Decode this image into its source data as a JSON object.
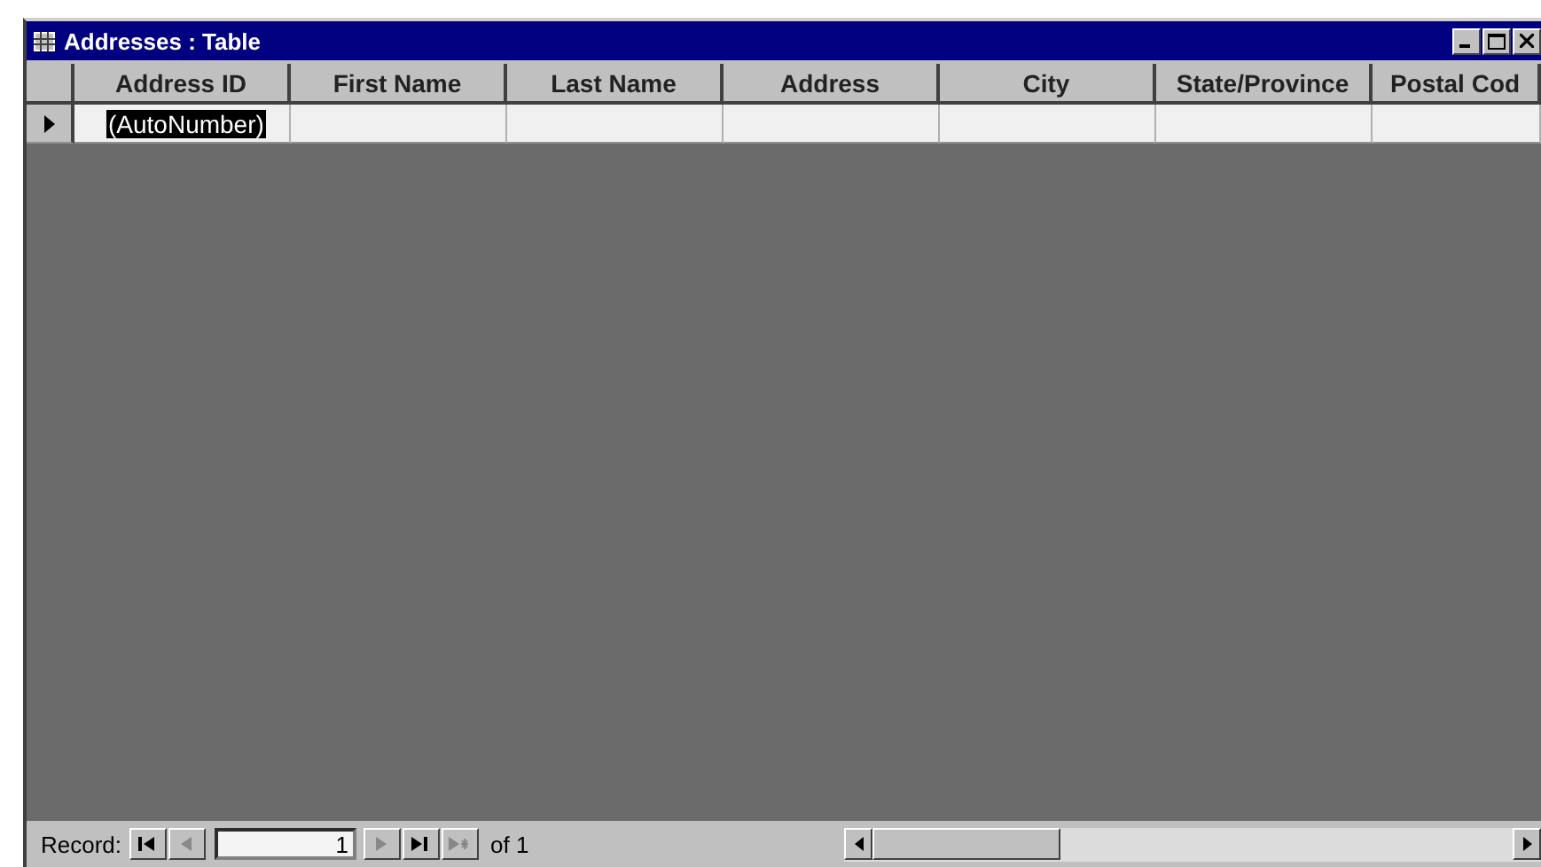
{
  "window": {
    "title": "Addresses : Table"
  },
  "table": {
    "columns": [
      "Address ID",
      "First Name",
      "Last Name",
      "Address",
      "City",
      "State/Province",
      "Postal Cod"
    ],
    "rows": [
      {
        "current": true,
        "address_id": {
          "text": "(AutoNumber)",
          "highlighted": true
        }
      }
    ]
  },
  "navigation": {
    "label": "Record:",
    "record": "1",
    "of_text": "of 1",
    "buttons": [
      {
        "kind": "first",
        "disabled": false
      },
      {
        "kind": "previous",
        "disabled": true
      },
      {
        "kind": "next",
        "disabled": true
      },
      {
        "kind": "last",
        "disabled": false
      },
      {
        "kind": "new",
        "disabled": true
      }
    ]
  }
}
